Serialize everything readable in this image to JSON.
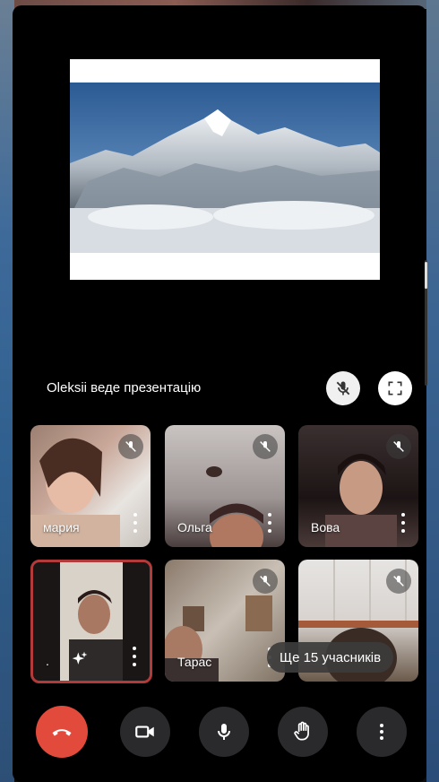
{
  "presentation": {
    "presenter_label": "Oleksii веде презентацію"
  },
  "participants": [
    {
      "name": "мария"
    },
    {
      "name": "Ольга"
    },
    {
      "name": "Вова"
    },
    {
      "name": "."
    },
    {
      "name": "Тарас"
    },
    {
      "name": ""
    }
  ],
  "participants_overflow": "Ще 15 учасників",
  "colors": {
    "end_call": "#e24a3b",
    "active_border": "#b33a3a",
    "control_bg": "#2a2a2c"
  },
  "controls": {
    "icons": [
      "end-call-icon",
      "camera-icon",
      "microphone-icon",
      "raise-hand-icon",
      "more-options-icon"
    ]
  }
}
